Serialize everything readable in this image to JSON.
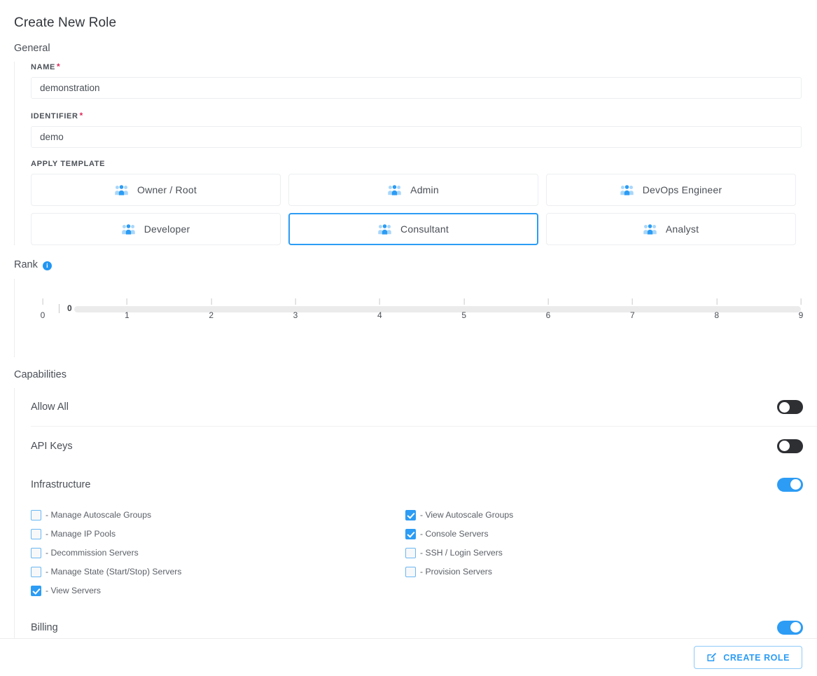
{
  "page": {
    "title": "Create New Role"
  },
  "general": {
    "section_label": "General",
    "name": {
      "label": "NAME",
      "required_mark": "*",
      "value": "demonstration",
      "placeholder": ""
    },
    "identifier": {
      "label": "IDENTIFIER",
      "required_mark": "*",
      "value": "demo",
      "placeholder": ""
    },
    "apply_template": {
      "label": "APPLY TEMPLATE",
      "icon": "users-icon",
      "selected": "Consultant",
      "options": [
        {
          "label": "Owner / Root",
          "selected": false
        },
        {
          "label": "Admin",
          "selected": false
        },
        {
          "label": "DevOps Engineer",
          "selected": false
        },
        {
          "label": "Developer",
          "selected": false
        },
        {
          "label": "Consultant",
          "selected": true
        },
        {
          "label": "Analyst",
          "selected": false
        }
      ]
    }
  },
  "rank": {
    "section_label": "Rank",
    "info_icon": "info-icon",
    "value": "0",
    "min": 0,
    "max": 9,
    "ticks": [
      "0",
      "1",
      "2",
      "3",
      "4",
      "5",
      "6",
      "7",
      "8",
      "9"
    ]
  },
  "capabilities": {
    "section_label": "Capabilities",
    "rows": [
      {
        "name": "Allow All",
        "enabled": false
      },
      {
        "name": "API Keys",
        "enabled": false
      },
      {
        "name": "Infrastructure",
        "enabled": true
      },
      {
        "name": "Billing",
        "enabled": true
      }
    ],
    "infrastructure_permissions": {
      "left": [
        {
          "label": "- Manage Autoscale Groups",
          "checked": false
        },
        {
          "label": "- Manage IP Pools",
          "checked": false
        },
        {
          "label": "- Decommission Servers",
          "checked": false
        },
        {
          "label": "- Manage State (Start/Stop) Servers",
          "checked": false
        },
        {
          "label": "- View Servers",
          "checked": true
        }
      ],
      "right": [
        {
          "label": "- View Autoscale Groups",
          "checked": true
        },
        {
          "label": "- Console Servers",
          "checked": true
        },
        {
          "label": "- SSH / Login Servers",
          "checked": false
        },
        {
          "label": "- Provision Servers",
          "checked": false
        }
      ]
    }
  },
  "footer": {
    "create_button": {
      "label": "CREATE ROLE",
      "icon": "edit-square-icon"
    }
  },
  "colors": {
    "accent": "#2c9cf4",
    "required": "#e0285a",
    "toggle_off": "#2d2f33",
    "track": "#ebebeb"
  }
}
